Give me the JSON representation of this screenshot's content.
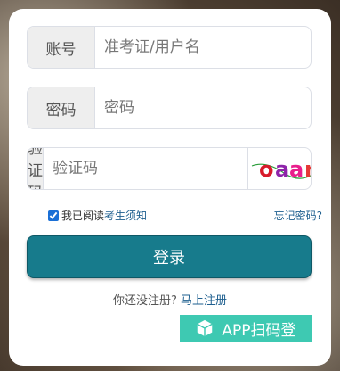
{
  "form": {
    "account": {
      "label": "账号",
      "placeholder": "准考证/用户名"
    },
    "password": {
      "label": "密码",
      "placeholder": "密码"
    },
    "captcha": {
      "label": "验证码",
      "placeholder": "验证码",
      "image_text": "oaar"
    }
  },
  "agree": {
    "checked": true,
    "prefix": "我已阅读",
    "link": "考生须知"
  },
  "forgot_label": "忘记密码?",
  "login_label": "登录",
  "register": {
    "prefix": "你还没注册?",
    "link": "马上注册"
  },
  "app_label": "APP扫码登",
  "colors": {
    "primary": "#177b8c",
    "app": "#3ec9b2",
    "link": "#1e5f8f"
  },
  "icons": {
    "app": "cube-icon"
  }
}
